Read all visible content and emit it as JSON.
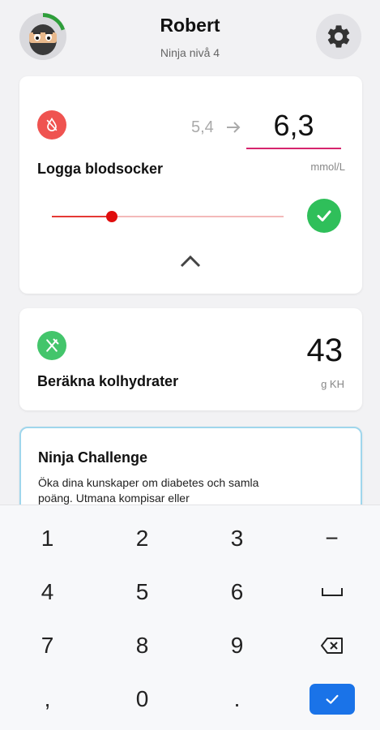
{
  "header": {
    "user_name": "Robert",
    "user_level": "Ninja nivå 4",
    "avatar_icon": "ninja-avatar-icon",
    "settings_icon": "gear-icon"
  },
  "glucose_card": {
    "title": "Logga blodsocker",
    "previous_value": "5,4",
    "current_value": "6,3",
    "unit": "mmol/L",
    "slider_level_fraction": 0.26,
    "icon": "blood-drop-icon",
    "accent_color": "#ef5350",
    "confirm_color": "#2fbf5a",
    "underline_color": "#d6246e"
  },
  "carbs_card": {
    "title": "Beräkna kolhydrater",
    "value": "43",
    "unit": "g KH",
    "icon": "fork-knife-icon",
    "accent_color": "#43c56b"
  },
  "challenge_card": {
    "title": "Ninja Challenge",
    "description": "Öka dina kunskaper om diabetes och samla poäng. Utmana kompisar eller",
    "border_color": "#9fd6ec"
  },
  "keyboard": {
    "rows": [
      [
        "1",
        "2",
        "3",
        "−"
      ],
      [
        "4",
        "5",
        "6",
        "␣"
      ],
      [
        "7",
        "8",
        "9",
        "⌫"
      ],
      [
        ",",
        "0",
        ".",
        "✓"
      ]
    ],
    "done_color": "#1a73e8"
  }
}
